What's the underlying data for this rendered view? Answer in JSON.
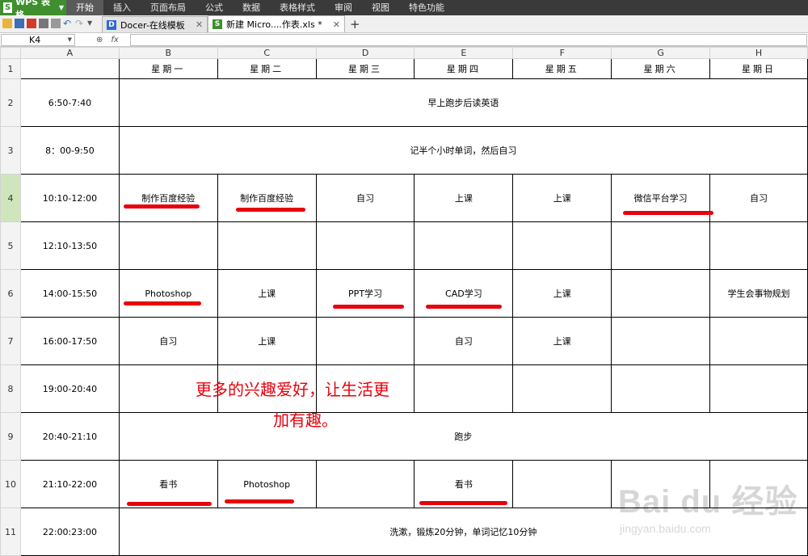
{
  "app": {
    "title": "WPS 表格"
  },
  "menu": [
    "开始",
    "插入",
    "页面布局",
    "公式",
    "数据",
    "表格样式",
    "审阅",
    "视图",
    "特色功能"
  ],
  "tabs": [
    {
      "label": "Docer-在线模板",
      "icon": "D"
    },
    {
      "label": "新建 Micro....作表.xls *",
      "icon": "S"
    }
  ],
  "formula_bar": {
    "name_box": "K4",
    "fx": "fx",
    "formula": ""
  },
  "columns": [
    "A",
    "B",
    "C",
    "D",
    "E",
    "F",
    "G",
    "H"
  ],
  "rows": [
    "1",
    "2",
    "3",
    "4",
    "5",
    "6",
    "7",
    "8",
    "9",
    "10",
    "11"
  ],
  "schedule": {
    "days": [
      "星期一",
      "星期二",
      "星期三",
      "星期四",
      "星期五",
      "星期六",
      "星期日"
    ],
    "r2": {
      "time": "6:50-7:40",
      "merged": "早上跑步后读英语"
    },
    "r3": {
      "time": "8：00-9:50",
      "merged": "记半个小时单词，然后自习"
    },
    "r4": {
      "time": "10:10-12:00",
      "cells": [
        "制作百度经验",
        "制作百度经验",
        "自习",
        "上课",
        "上课",
        "微信平台学习",
        "自习"
      ]
    },
    "r5": {
      "time": "12:10-13:50",
      "cells": [
        "",
        "",
        "",
        "",
        "",
        "",
        ""
      ]
    },
    "r6": {
      "time": "14:00-15:50",
      "cells": [
        "Photoshop",
        "上课",
        "PPT学习",
        "CAD学习",
        "上课",
        "",
        "学生会事物规划"
      ]
    },
    "r7": {
      "time": "16:00-17:50",
      "cells": [
        "自习",
        "上课",
        "",
        "自习",
        "上课",
        "",
        ""
      ]
    },
    "r8": {
      "time": "19:00-20:40",
      "cells": [
        "",
        "",
        "",
        "",
        "",
        "",
        ""
      ]
    },
    "r9": {
      "time": "20:40-21:10",
      "merged": "跑步"
    },
    "r10": {
      "time": "21:10-22:00",
      "cells": [
        "看书",
        "Photoshop",
        "",
        "看书",
        "",
        "",
        ""
      ]
    },
    "r11": {
      "time": "22:00:23:00",
      "merged": "洗漱，锻炼20分钟，单词记忆10分钟"
    }
  },
  "annotation": {
    "line1": "更多的兴趣爱好，让生活更",
    "line2": "加有趣。"
  },
  "watermark": {
    "main": "Bai du 经验",
    "sub": "jingyan.baidu.com"
  },
  "colors": {
    "underline": "#e8000b",
    "menubar": "#3a3a3a",
    "app_button": "#3f8f2e",
    "row_selected": "#cfe6bd"
  }
}
